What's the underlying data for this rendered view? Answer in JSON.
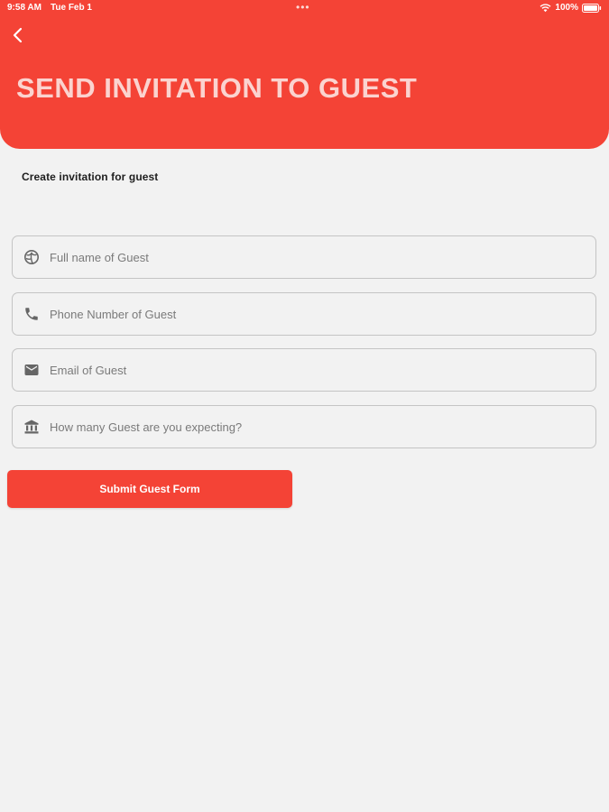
{
  "status_bar": {
    "time": "9:58 AM",
    "date": "Tue Feb 1",
    "battery": "100%"
  },
  "header": {
    "title": "SEND INVITATION TO GUEST",
    "color": "#f44336",
    "title_color": "#fbd3cf"
  },
  "form": {
    "subtitle": "Create invitation for guest",
    "fields": [
      {
        "name": "full-name",
        "icon": "globe-icon",
        "placeholder": "Full name of Guest",
        "value": ""
      },
      {
        "name": "phone",
        "icon": "phone-icon",
        "placeholder": "Phone Number of Guest",
        "value": ""
      },
      {
        "name": "email",
        "icon": "envelope-icon",
        "placeholder": "Email of Guest",
        "value": ""
      },
      {
        "name": "guest-count",
        "icon": "building-icon",
        "placeholder": "How many Guest are you expecting?",
        "value": ""
      }
    ],
    "submit_label": "Submit Guest Form"
  }
}
